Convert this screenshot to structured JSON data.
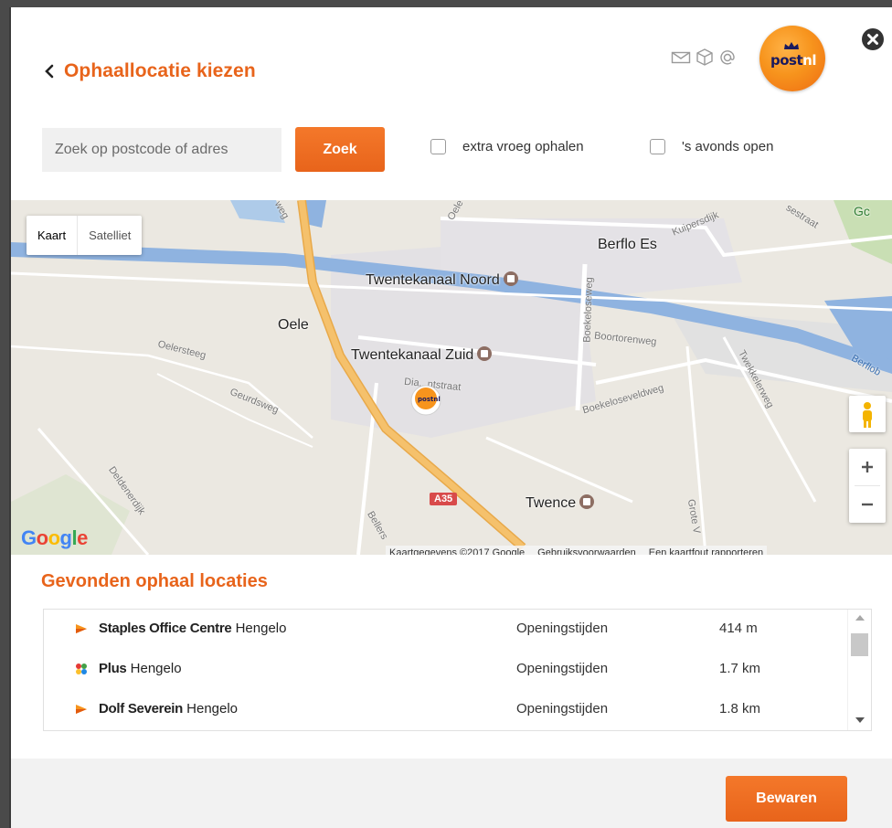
{
  "header": {
    "back_icon": "chevron-left-icon",
    "title": "Ophaallocatie kiezen",
    "channel_icons": [
      "envelope-icon",
      "package-icon",
      "at-sign-icon"
    ],
    "logo_text_post": "post",
    "logo_text_nl": "nl",
    "close_icon": "close-circle-icon"
  },
  "search": {
    "placeholder": "Zoek op postcode of adres",
    "button_label": "Zoek"
  },
  "filters": [
    {
      "label": "extra vroeg ophalen",
      "checked": false
    },
    {
      "label": "'s avonds open",
      "checked": false
    }
  ],
  "map": {
    "type_controls": [
      "Kaart",
      "Satelliet"
    ],
    "active_type": "Kaart",
    "places": {
      "berflo_es": "Berflo Es",
      "twentekanaal_noord": "Twentekanaal Noord",
      "oele": "Oele",
      "twentekanaal_zuid": "Twentekanaal Zuid",
      "twence": "Twence",
      "g_partial": "Gc"
    },
    "streets": {
      "oelersteeg": "Oelersteeg",
      "geurdsweg": "Geurdsweg",
      "deldenerdijk": "Deldenerdijk",
      "boekeloseweg": "Boekeloseweg",
      "boortorenweg": "Boortorenweg",
      "boekeloseveldweg": "Boekeloseveldweg",
      "twekkelerweg": "Twekkelerweg",
      "diamantstraat": "Dia...ntstraat",
      "kuipersdijk": "Kuipersdijk",
      "berflobrug": "Berflob",
      "bellers": "Bellers",
      "grote_v": "Grote V",
      "oele_top": "Oele",
      "weg_top": "weg",
      "sestraat": "sestraat"
    },
    "road_number": "A35",
    "google_logo": [
      "G",
      "o",
      "o",
      "g",
      "l",
      "e"
    ],
    "attribution": "Kaartgegevens ©2017 Google",
    "terms_link": "Gebruiksvoorwaarden",
    "report_link": "Een kaartfout rapporteren",
    "zoom_in": "+",
    "zoom_out": "−",
    "pegman_icon": "pegman-icon",
    "marker_icon": "postnl-marker-icon"
  },
  "results": {
    "title": "Gevonden ophaal locaties",
    "items": [
      {
        "icon": "postnl-point-icon",
        "name": "Staples Office Centre",
        "city": "Hengelo",
        "hours": "Openingstijden",
        "distance": "414 m"
      },
      {
        "icon": "plus-store-icon",
        "name": "Plus",
        "city": "Hengelo",
        "hours": "Openingstijden",
        "distance": "1.7 km"
      },
      {
        "icon": "postnl-point-icon",
        "name": "Dolf Severein",
        "city": "Hengelo",
        "hours": "Openingstijden",
        "distance": "1.8 km"
      }
    ]
  },
  "footer": {
    "save_label": "Bewaren"
  },
  "colors": {
    "accent": "#e8641b",
    "map_bg": "#ebe8e1",
    "water": "#8fb3e0",
    "highway": "#f5c16c"
  }
}
